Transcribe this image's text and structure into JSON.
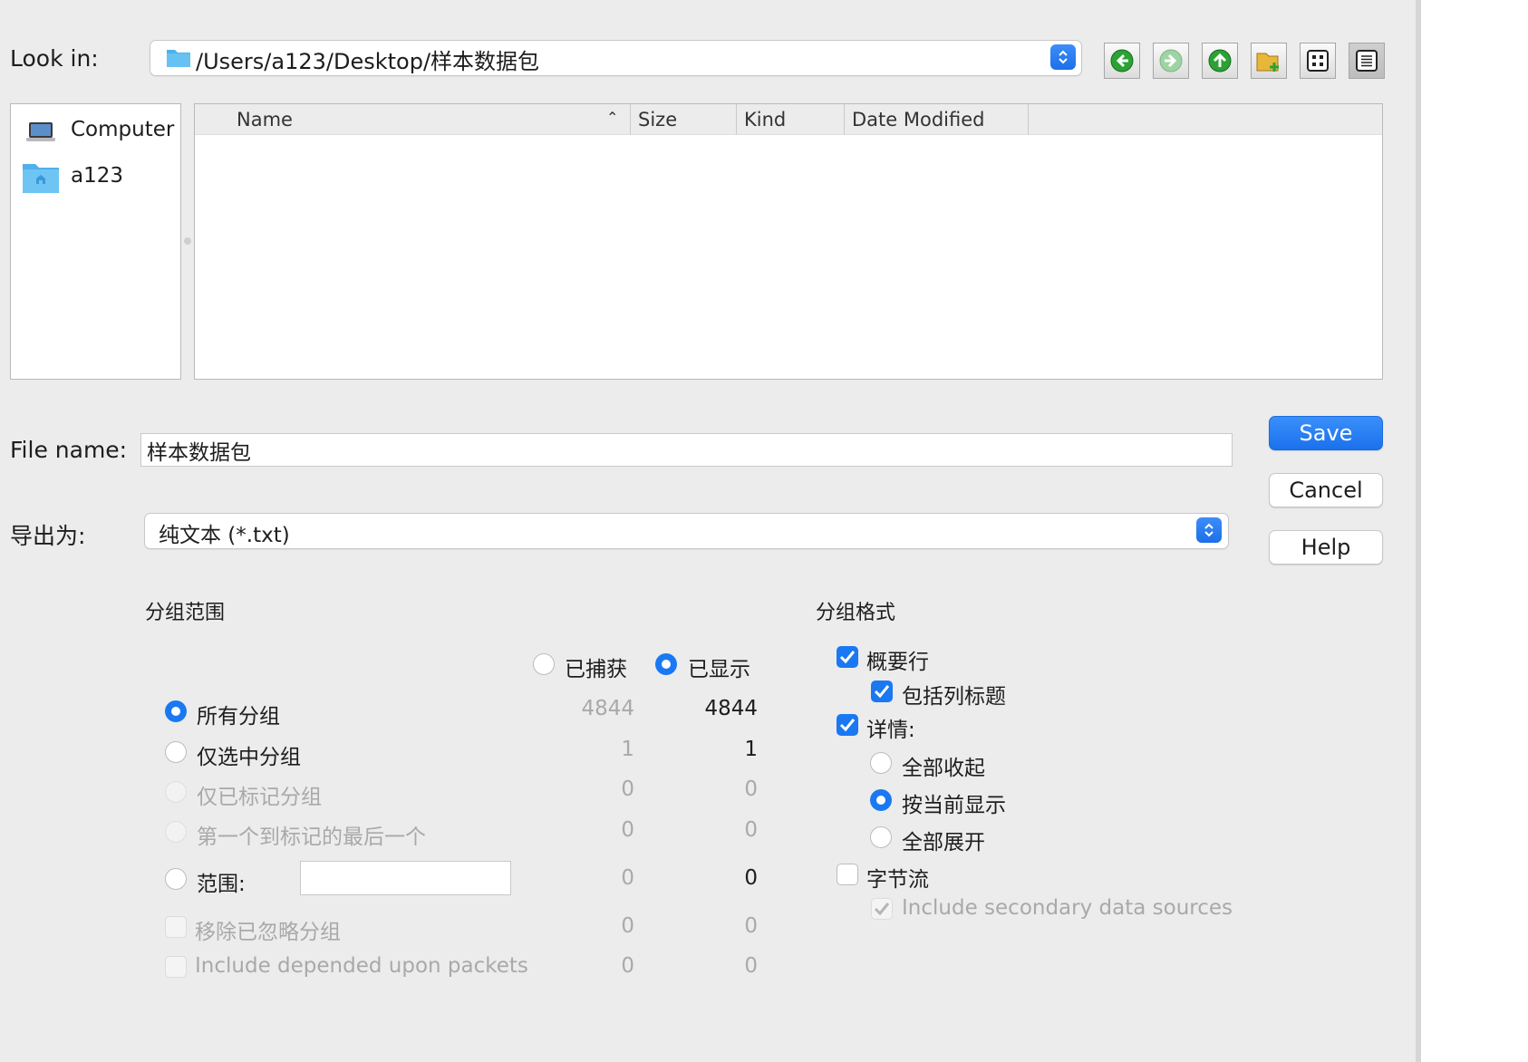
{
  "look_in": {
    "label": "Look in:",
    "path": "/Users/a123/Desktop/样本数据包"
  },
  "toolbar": {
    "back_icon": "back-arrow-icon",
    "forward_icon": "forward-arrow-icon",
    "up_icon": "up-arrow-icon",
    "new_folder_icon": "new-folder-icon",
    "list_view_icon": "list-view-icon",
    "details_view_icon": "details-view-icon"
  },
  "sidebar": {
    "items": [
      {
        "label": "Computer",
        "icon": "laptop-icon"
      },
      {
        "label": "a123",
        "icon": "home-folder-icon"
      }
    ]
  },
  "file_list": {
    "columns": [
      "Name",
      "Size",
      "Kind",
      "Date Modified"
    ],
    "rows": []
  },
  "file_name": {
    "label": "File name:",
    "value": "样本数据包"
  },
  "export_as": {
    "label": "导出为:",
    "value": "纯文本 (*.txt)"
  },
  "buttons": {
    "save": "Save",
    "cancel": "Cancel",
    "help": "Help"
  },
  "packet_range": {
    "title": "分组范围",
    "captured_label": "已捕获",
    "displayed_label": "已显示",
    "rows": [
      {
        "label": "所有分组",
        "captured": "4844",
        "displayed": "4844"
      },
      {
        "label": "仅选中分组",
        "captured": "1",
        "displayed": "1"
      },
      {
        "label": "仅已标记分组",
        "captured": "0",
        "displayed": "0"
      },
      {
        "label": "第一个到标记的最后一个",
        "captured": "0",
        "displayed": "0"
      },
      {
        "label": "范围:",
        "captured": "0",
        "displayed": "0",
        "input_value": ""
      },
      {
        "label": "移除已忽略分组",
        "captured": "0",
        "displayed": "0"
      },
      {
        "label": "Include depended upon packets",
        "captured": "0",
        "displayed": "0"
      }
    ]
  },
  "packet_format": {
    "title": "分组格式",
    "summary_line": "概要行",
    "include_column_headings": "包括列标题",
    "details": "详情:",
    "all_collapsed": "全部收起",
    "as_displayed": "按当前显示",
    "all_expanded": "全部展开",
    "bytes": "字节流",
    "include_secondary": "Include secondary data sources"
  },
  "colors": {
    "accent": "#1a78f2",
    "window_bg": "#ececec"
  }
}
